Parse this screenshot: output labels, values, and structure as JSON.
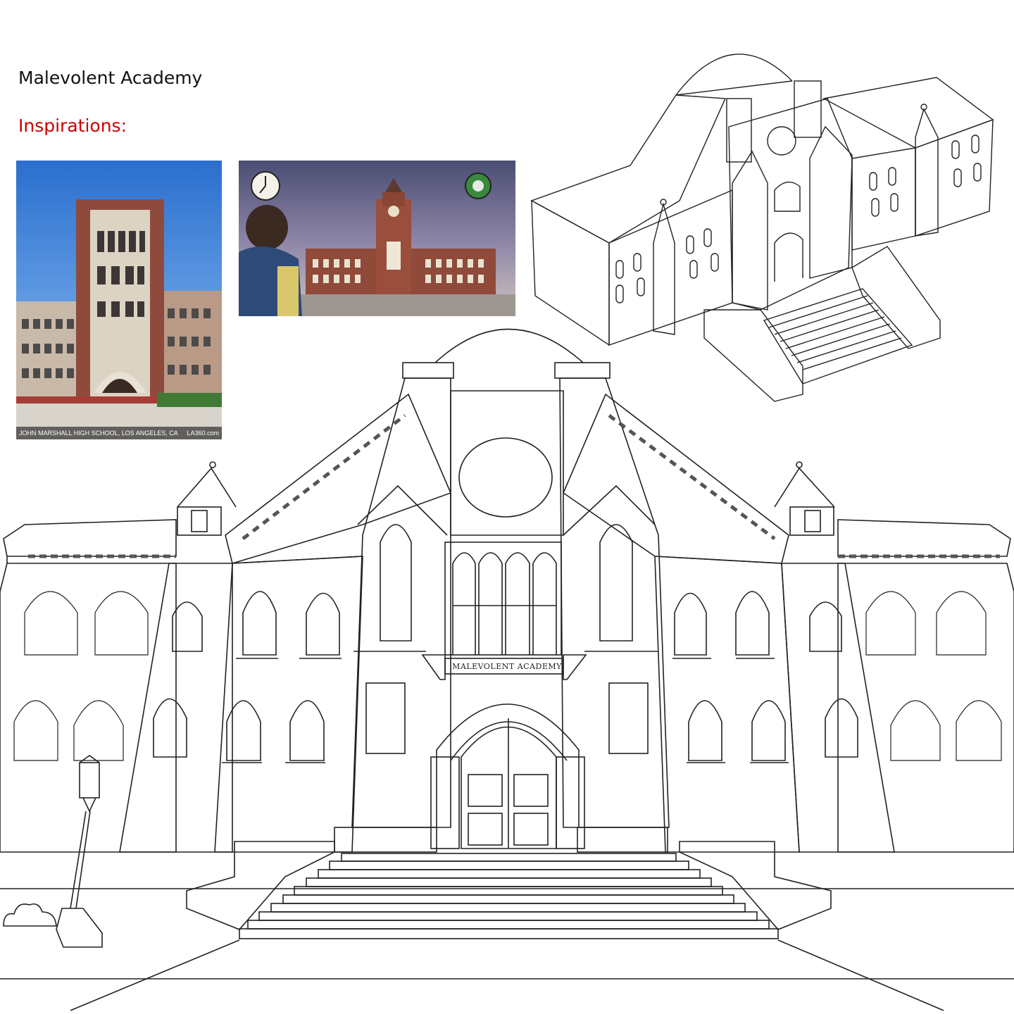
{
  "page": {
    "title": "Malevolent Academy",
    "subtitle": "Inspirations:",
    "subtitle_color": "#cc0000"
  },
  "inspirations": [
    {
      "caption_left": "JOHN MARSHALL HIGH SCHOOL, LOS ANGELES, CA",
      "caption_right": "LA360.com"
    },
    {
      "caption_left": "",
      "caption_right": ""
    }
  ],
  "building": {
    "sign_text": "MALEVOLENT ACADEMY",
    "line_color": "#222222"
  }
}
